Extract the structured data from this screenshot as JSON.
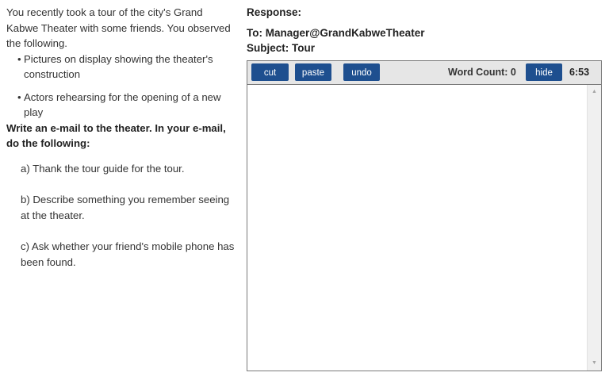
{
  "prompt": {
    "intro": "You recently took a tour of the city's Grand Kabwe Theater with some friends. You observed the following.",
    "observations": [
      "Pictures on display showing the theater's construction",
      "Actors rehearsing for the opening of a new play"
    ],
    "bullet_glyph": "•",
    "instruction": "Write an e-mail to the theater. In your e-mail, do the following:",
    "tasks": [
      "a) Thank the tour guide for the tour.",
      "b) Describe something you remember seeing at the theater.",
      "c) Ask whether your friend's mobile phone has been found."
    ]
  },
  "response": {
    "label": "Response:",
    "to_line": "To: Manager@GrandKabweTheater",
    "subject_line": "Subject: Tour"
  },
  "toolbar": {
    "cut_label": "cut",
    "paste_label": "paste",
    "undo_label": "undo",
    "word_count": "Word Count: 0",
    "hide_label": "hide",
    "timer": "6:53"
  },
  "editor": {
    "value": "",
    "scroll_up_glyph": "▲",
    "scroll_down_glyph": "▼"
  },
  "colors": {
    "button_bg": "#1e4f8f",
    "toolbar_bg": "#e6e6e6",
    "text": "#333333"
  },
  "icons": {
    "scroll_up": "scroll-up-arrow-icon",
    "scroll_down": "scroll-down-arrow-icon"
  }
}
